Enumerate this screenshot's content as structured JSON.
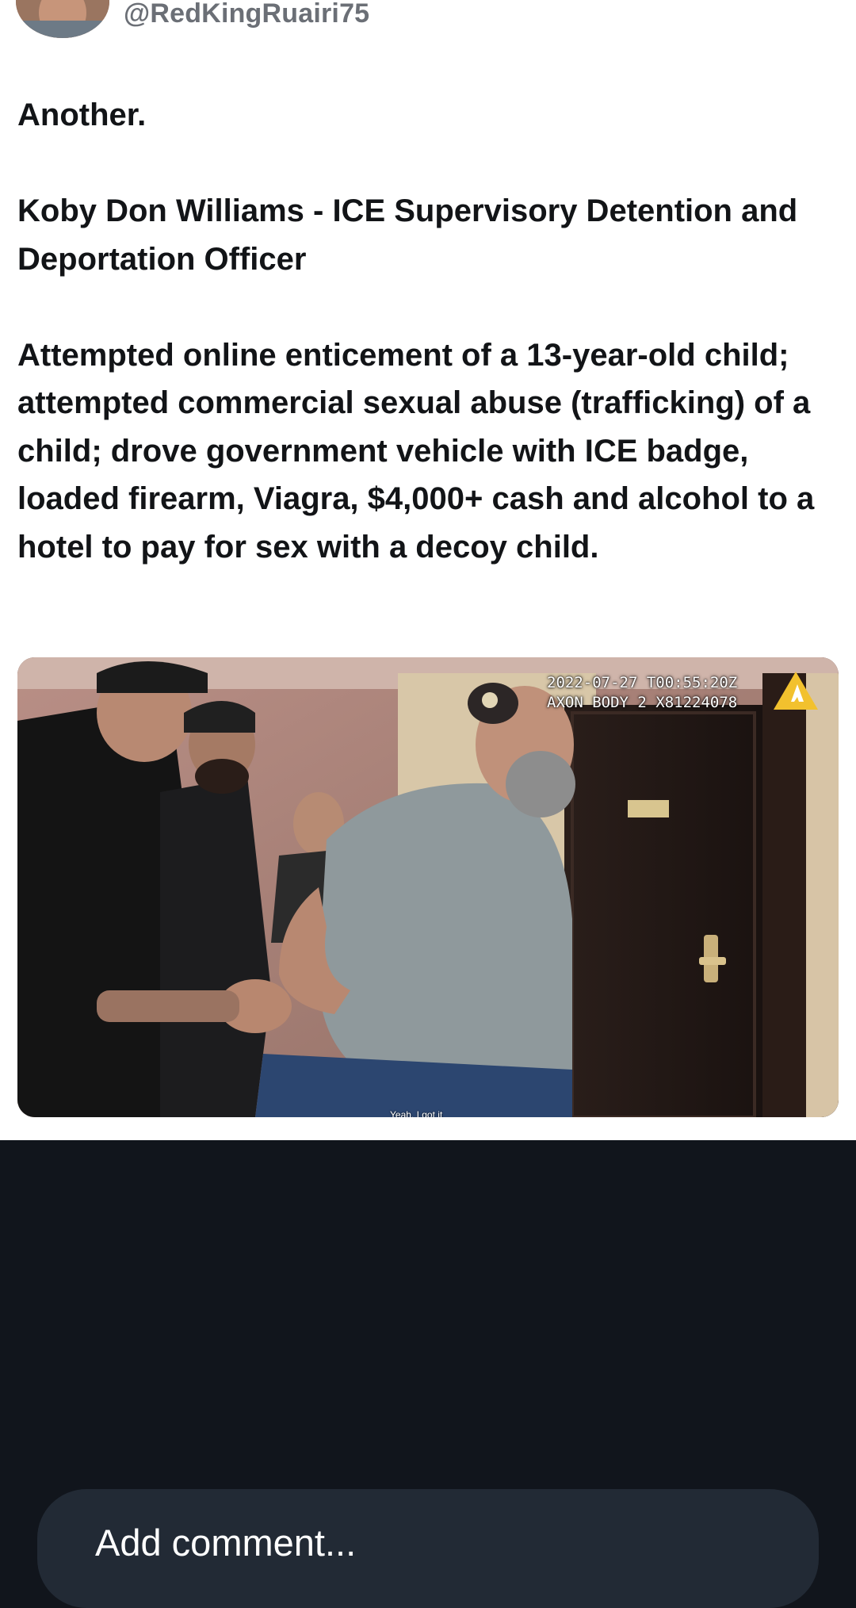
{
  "post": {
    "author_handle": "@RedKingRuairi75",
    "paragraphs": [
      "Another.",
      "Koby Don Williams - ICE Supervisory Detention and Deportation Officer",
      "Attempted online enticement of a 13-year-old child; attempted commercial sexual abuse (trafficking) of a child; drove government vehicle with ICE badge, loaded firearm, Viagra, $4,000+ cash and alcohol to a hotel to pay for sex with a decoy child."
    ],
    "media": {
      "timestamp_line": "2022-07-27 T00:55:20Z",
      "device_line": "AXON BODY 2 X81224078",
      "caption": "Yeah, I got it"
    }
  },
  "comment": {
    "placeholder": "Add comment..."
  },
  "colors": {
    "post_background": "#ffffff",
    "page_background": "#11151c",
    "comment_bar": "#222a35",
    "axon_yellow": "#f2c12e"
  }
}
